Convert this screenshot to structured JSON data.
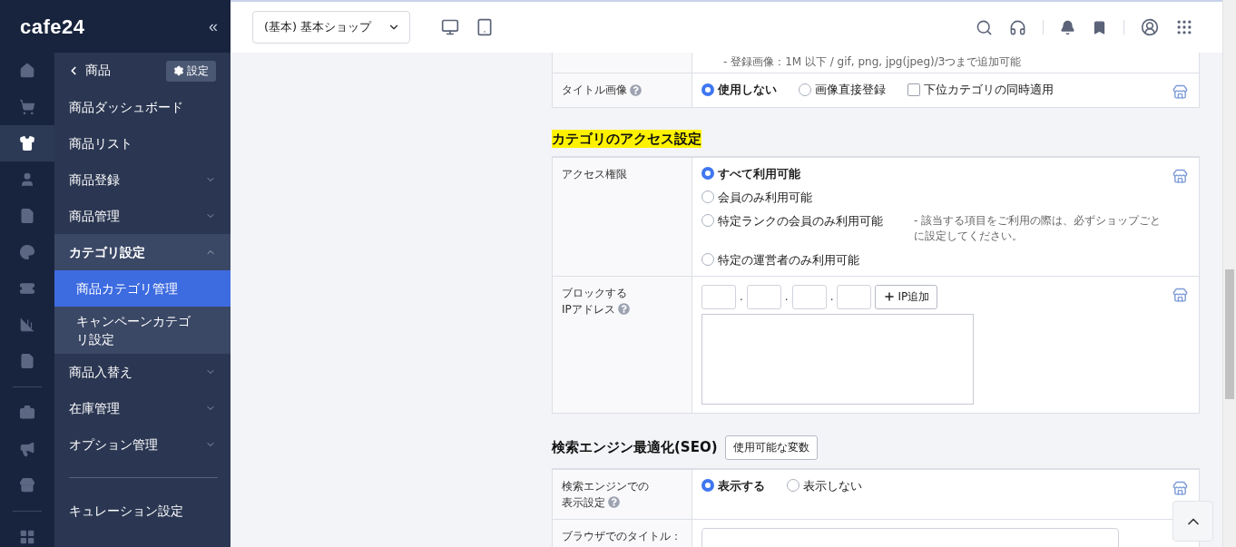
{
  "logo": "cafe24",
  "collapse": "«",
  "rail": [
    {
      "kind": "home",
      "selected": false
    },
    {
      "kind": "cart",
      "selected": false
    },
    {
      "kind": "shirt",
      "selected": true
    },
    {
      "kind": "user",
      "selected": false
    },
    {
      "kind": "document",
      "selected": false
    },
    {
      "kind": "palette",
      "selected": false
    },
    {
      "kind": "ticket",
      "selected": false
    },
    {
      "kind": "chart",
      "selected": false
    },
    {
      "kind": "sheet",
      "selected": false
    },
    {
      "kind": "divider"
    },
    {
      "kind": "briefcase",
      "selected": false
    },
    {
      "kind": "megaphone",
      "selected": false
    },
    {
      "kind": "store",
      "selected": false
    },
    {
      "kind": "divider"
    },
    {
      "kind": "apps",
      "selected": false
    }
  ],
  "sidebar": {
    "back": "商品",
    "settings": "設定",
    "items": [
      {
        "kind": "link",
        "label": "商品ダッシュボード",
        "selected": false
      },
      {
        "kind": "link",
        "label": "商品リスト",
        "selected": false
      },
      {
        "kind": "link",
        "label": "商品登録",
        "selected": false,
        "expanded": false
      },
      {
        "kind": "link",
        "label": "商品管理",
        "selected": false,
        "expanded": false
      },
      {
        "kind": "link",
        "label": "カテゴリ設定",
        "selected": false,
        "expanded": true,
        "children": [
          {
            "label": "商品カテゴリ管理",
            "selected": true
          },
          {
            "label": "キャンペーンカテゴリ設定",
            "selected": false
          }
        ]
      },
      {
        "kind": "link",
        "label": "商品入替え",
        "selected": false,
        "expanded": false
      },
      {
        "kind": "link",
        "label": "在庫管理",
        "selected": false,
        "expanded": false
      },
      {
        "kind": "link",
        "label": "オプション管理",
        "selected": false,
        "expanded": false
      },
      {
        "kind": "divider"
      },
      {
        "kind": "link",
        "label": "キュレーション設定",
        "selected": false
      }
    ]
  },
  "header": {
    "shop_select": "(基本) 基本ショップ"
  },
  "sections": [
    {
      "rows": [
        {
          "kind": "note",
          "label": [],
          "note": "- 登録画像：1M 以下 / gif, png, jpg(jpeg)/3つまで追加可能"
        },
        {
          "kind": "inline",
          "label": [
            "タイトル画像"
          ],
          "help": true,
          "store": true,
          "options": [
            {
              "kind": "radio",
              "label": "使用しない",
              "selected": true
            },
            {
              "kind": "radio",
              "label": "画像直接登録",
              "selected": false
            },
            {
              "kind": "checkbox",
              "label": "下位カテゴリの同時適用",
              "checked": false
            }
          ]
        }
      ]
    },
    {
      "title": "カテゴリのアクセス設定",
      "highlighted": true,
      "rows": [
        {
          "kind": "stack",
          "label": [
            "アクセス権限"
          ],
          "store": true,
          "options": [
            {
              "kind": "radio",
              "label": "すべて利用可能",
              "selected": true
            },
            {
              "kind": "radio",
              "label": "会員のみ利用可能",
              "selected": false
            },
            {
              "kind": "radio",
              "label": "特定ランクの会員のみ利用可能",
              "selected": false,
              "note": "- 該当する項目をご利用の際は、必ずショップごとに設定してください。"
            },
            {
              "kind": "radio",
              "label": "特定の運営者のみ利用可能",
              "selected": false
            }
          ]
        },
        {
          "kind": "ip",
          "label": [
            "ブロックする",
            "IPアドレス"
          ],
          "help": true,
          "store": true,
          "separator": ".",
          "button": "IP追加"
        }
      ]
    },
    {
      "title": "検索エンジン最適化(SEO)",
      "highlighted": false,
      "title_button": "使用可能な変数",
      "rows": [
        {
          "kind": "inline",
          "label": [
            "検索エンジンでの",
            "表示設定"
          ],
          "help": true,
          "store": true,
          "options": [
            {
              "kind": "radio",
              "label": "表示する",
              "selected": true
            },
            {
              "kind": "radio",
              "label": "表示しない",
              "selected": false
            }
          ]
        },
        {
          "kind": "text",
          "label": [
            "ブラウザでのタイトル："
          ]
        }
      ]
    }
  ]
}
